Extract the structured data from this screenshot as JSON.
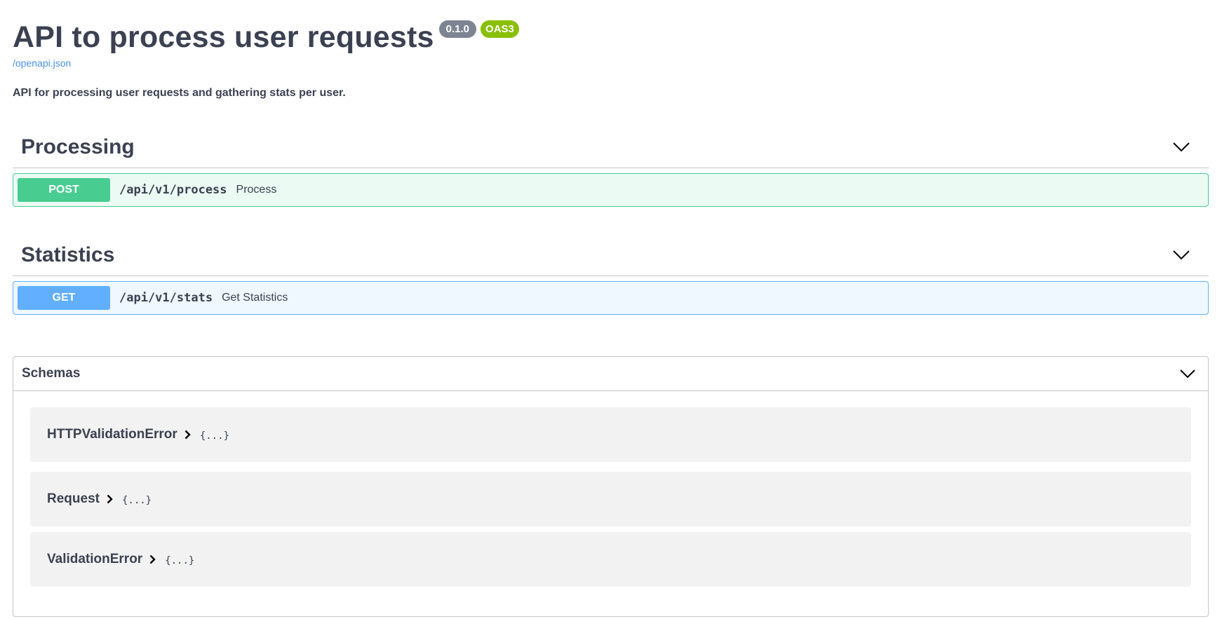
{
  "info": {
    "title": "API to process user requests",
    "version": "0.1.0",
    "oas": "OAS3",
    "spec_link": "/openapi.json",
    "description": "API for processing user requests and gathering stats per user."
  },
  "tags": [
    {
      "name": "Processing",
      "operation": {
        "method": "POST",
        "path": "/api/v1/process",
        "summary": "Process"
      }
    },
    {
      "name": "Statistics",
      "operation": {
        "method": "GET",
        "path": "/api/v1/stats",
        "summary": "Get Statistics"
      }
    }
  ],
  "schemas": {
    "title": "Schemas",
    "models": [
      {
        "name": "HTTPValidationError",
        "brace": "{...}"
      },
      {
        "name": "Request",
        "brace": "{...}"
      },
      {
        "name": "ValidationError",
        "brace": "{...}"
      }
    ]
  },
  "colors": {
    "post": "#49cc90",
    "get": "#61affe",
    "version_badge": "#7d8492",
    "oas_badge": "#89bf04",
    "link": "#4990e2"
  },
  "icons": {
    "section_toggle": "chevron-down-icon",
    "model_toggle": "chevron-right-icon"
  }
}
